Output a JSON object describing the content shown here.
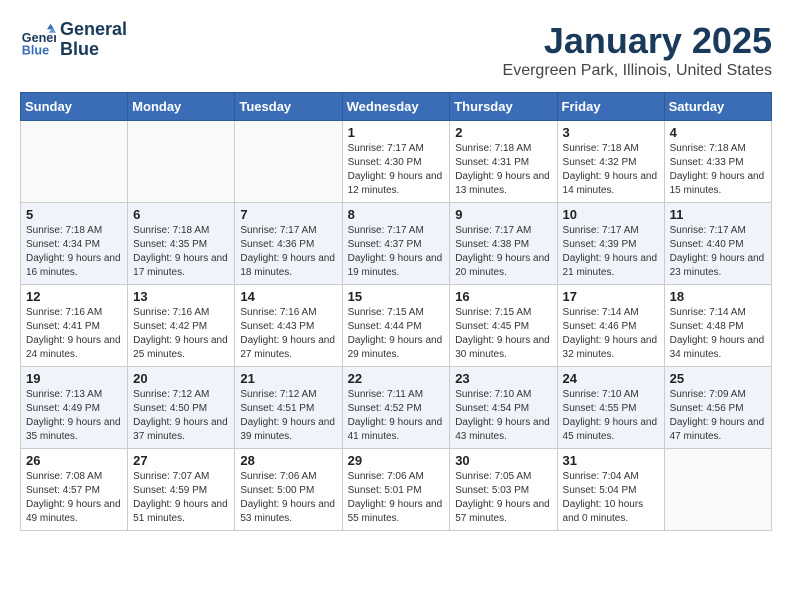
{
  "logo": {
    "line1": "General",
    "line2": "Blue"
  },
  "title": "January 2025",
  "location": "Evergreen Park, Illinois, United States",
  "days_of_week": [
    "Sunday",
    "Monday",
    "Tuesday",
    "Wednesday",
    "Thursday",
    "Friday",
    "Saturday"
  ],
  "weeks": [
    [
      {
        "day": "",
        "content": ""
      },
      {
        "day": "",
        "content": ""
      },
      {
        "day": "",
        "content": ""
      },
      {
        "day": "1",
        "content": "Sunrise: 7:17 AM\nSunset: 4:30 PM\nDaylight: 9 hours and 12 minutes."
      },
      {
        "day": "2",
        "content": "Sunrise: 7:18 AM\nSunset: 4:31 PM\nDaylight: 9 hours and 13 minutes."
      },
      {
        "day": "3",
        "content": "Sunrise: 7:18 AM\nSunset: 4:32 PM\nDaylight: 9 hours and 14 minutes."
      },
      {
        "day": "4",
        "content": "Sunrise: 7:18 AM\nSunset: 4:33 PM\nDaylight: 9 hours and 15 minutes."
      }
    ],
    [
      {
        "day": "5",
        "content": "Sunrise: 7:18 AM\nSunset: 4:34 PM\nDaylight: 9 hours and 16 minutes."
      },
      {
        "day": "6",
        "content": "Sunrise: 7:18 AM\nSunset: 4:35 PM\nDaylight: 9 hours and 17 minutes."
      },
      {
        "day": "7",
        "content": "Sunrise: 7:17 AM\nSunset: 4:36 PM\nDaylight: 9 hours and 18 minutes."
      },
      {
        "day": "8",
        "content": "Sunrise: 7:17 AM\nSunset: 4:37 PM\nDaylight: 9 hours and 19 minutes."
      },
      {
        "day": "9",
        "content": "Sunrise: 7:17 AM\nSunset: 4:38 PM\nDaylight: 9 hours and 20 minutes."
      },
      {
        "day": "10",
        "content": "Sunrise: 7:17 AM\nSunset: 4:39 PM\nDaylight: 9 hours and 21 minutes."
      },
      {
        "day": "11",
        "content": "Sunrise: 7:17 AM\nSunset: 4:40 PM\nDaylight: 9 hours and 23 minutes."
      }
    ],
    [
      {
        "day": "12",
        "content": "Sunrise: 7:16 AM\nSunset: 4:41 PM\nDaylight: 9 hours and 24 minutes."
      },
      {
        "day": "13",
        "content": "Sunrise: 7:16 AM\nSunset: 4:42 PM\nDaylight: 9 hours and 25 minutes."
      },
      {
        "day": "14",
        "content": "Sunrise: 7:16 AM\nSunset: 4:43 PM\nDaylight: 9 hours and 27 minutes."
      },
      {
        "day": "15",
        "content": "Sunrise: 7:15 AM\nSunset: 4:44 PM\nDaylight: 9 hours and 29 minutes."
      },
      {
        "day": "16",
        "content": "Sunrise: 7:15 AM\nSunset: 4:45 PM\nDaylight: 9 hours and 30 minutes."
      },
      {
        "day": "17",
        "content": "Sunrise: 7:14 AM\nSunset: 4:46 PM\nDaylight: 9 hours and 32 minutes."
      },
      {
        "day": "18",
        "content": "Sunrise: 7:14 AM\nSunset: 4:48 PM\nDaylight: 9 hours and 34 minutes."
      }
    ],
    [
      {
        "day": "19",
        "content": "Sunrise: 7:13 AM\nSunset: 4:49 PM\nDaylight: 9 hours and 35 minutes."
      },
      {
        "day": "20",
        "content": "Sunrise: 7:12 AM\nSunset: 4:50 PM\nDaylight: 9 hours and 37 minutes."
      },
      {
        "day": "21",
        "content": "Sunrise: 7:12 AM\nSunset: 4:51 PM\nDaylight: 9 hours and 39 minutes."
      },
      {
        "day": "22",
        "content": "Sunrise: 7:11 AM\nSunset: 4:52 PM\nDaylight: 9 hours and 41 minutes."
      },
      {
        "day": "23",
        "content": "Sunrise: 7:10 AM\nSunset: 4:54 PM\nDaylight: 9 hours and 43 minutes."
      },
      {
        "day": "24",
        "content": "Sunrise: 7:10 AM\nSunset: 4:55 PM\nDaylight: 9 hours and 45 minutes."
      },
      {
        "day": "25",
        "content": "Sunrise: 7:09 AM\nSunset: 4:56 PM\nDaylight: 9 hours and 47 minutes."
      }
    ],
    [
      {
        "day": "26",
        "content": "Sunrise: 7:08 AM\nSunset: 4:57 PM\nDaylight: 9 hours and 49 minutes."
      },
      {
        "day": "27",
        "content": "Sunrise: 7:07 AM\nSunset: 4:59 PM\nDaylight: 9 hours and 51 minutes."
      },
      {
        "day": "28",
        "content": "Sunrise: 7:06 AM\nSunset: 5:00 PM\nDaylight: 9 hours and 53 minutes."
      },
      {
        "day": "29",
        "content": "Sunrise: 7:06 AM\nSunset: 5:01 PM\nDaylight: 9 hours and 55 minutes."
      },
      {
        "day": "30",
        "content": "Sunrise: 7:05 AM\nSunset: 5:03 PM\nDaylight: 9 hours and 57 minutes."
      },
      {
        "day": "31",
        "content": "Sunrise: 7:04 AM\nSunset: 5:04 PM\nDaylight: 10 hours and 0 minutes."
      },
      {
        "day": "",
        "content": ""
      }
    ]
  ]
}
